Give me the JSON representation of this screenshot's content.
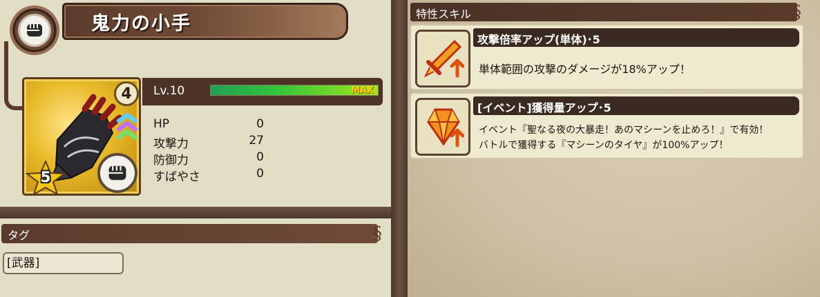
{
  "item": {
    "name": "鬼力の小手",
    "card_level": "4",
    "rarity": "5",
    "type_icon": "fist-icon"
  },
  "level": {
    "label": "Lv.10",
    "max_label": "MAX",
    "progress": 1.0
  },
  "stats": [
    {
      "label": "HP",
      "value": "0"
    },
    {
      "label": "攻撃力",
      "value": "27"
    },
    {
      "label": "防御力",
      "value": "0"
    },
    {
      "label": "すばやさ",
      "value": "0"
    }
  ],
  "tags": {
    "header": "タグ",
    "items": [
      "[武器]"
    ]
  },
  "skills": {
    "header": "特性スキル",
    "items": [
      {
        "title": "攻撃倍率アップ(単体)･5",
        "desc_lines": [
          "単体範囲の攻撃のダメージが18%アップ！"
        ],
        "icon": "sword-up-icon"
      },
      {
        "title": "[イベント]獲得量アップ･5",
        "desc_lines": [
          "イベント『聖なる夜の大暴走！あのマシーンを止めろ！』で有効！",
          "バトルで獲得する『マシーンのタイヤ』が100%アップ！"
        ],
        "icon": "gem-up-icon"
      }
    ]
  },
  "colors": {
    "panel": "#e2dec6",
    "header": "#5a3b2b",
    "gold": "#e8b928",
    "xp_green": "#35c43a"
  }
}
